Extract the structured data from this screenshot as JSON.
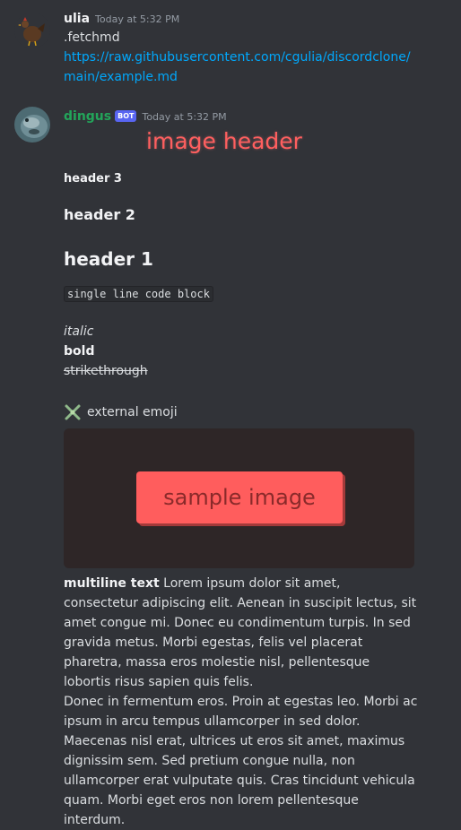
{
  "messages": [
    {
      "username": "ulia",
      "timestamp": "Today at 5:32 PM",
      "text": ".fetchmd",
      "link": "https://raw.githubusercontent.com/cgulia/discordclone/main/example.md"
    },
    {
      "username": "dingus",
      "bot_tag": "BOT",
      "timestamp": "Today at 5:32 PM",
      "image_header": "image header",
      "header3": "header 3",
      "header2": "header 2",
      "header1": "header 1",
      "code": "single line code block",
      "italic": "italic",
      "bold": "bold",
      "strike": "strikethrough",
      "emoji_text": "external emoji",
      "sample_image_text": "sample image",
      "multiline_label": "multiline text",
      "para1": "Lorem ipsum dolor sit amet, consectetur adipiscing elit. Aenean in suscipit lectus, sit amet congue mi. Donec eu condimentum turpis. In sed gravida metus. Morbi egestas, felis vel placerat pharetra, massa eros molestie nisl, pellentesque lobortis risus sapien quis felis.",
      "para2": "Donec in fermentum eros. Proin at egestas leo. Morbi ac ipsum in arcu tempus ullamcorper in sed dolor. Maecenas nisl erat, ultrices ut eros sit amet, maximus dignissim sem. Sed pretium congue nulla, non ullamcorper erat vulputate quis. Cras tincidunt vehicula quam. Morbi eget eros non lorem pellentesque interdum."
    }
  ],
  "colors": {
    "background": "#313338",
    "link": "#00a8fc",
    "bot_name": "#23a55a",
    "bot_tag": "#5865f2",
    "image_header": "#ff5f5f"
  },
  "icons": {
    "user_avatar": "chicken-avatar",
    "bot_avatar": "fish-avatar",
    "emoji": "sparkle-cross-icon"
  }
}
